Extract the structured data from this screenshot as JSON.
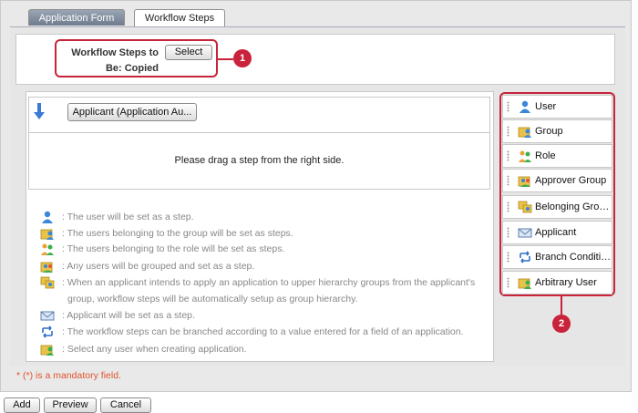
{
  "tabs": [
    {
      "label": "Application Form",
      "active": false
    },
    {
      "label": "Workflow Steps",
      "active": true
    }
  ],
  "copy_section": {
    "label": "Workflow Steps to Be: Copied",
    "select_label": "Select"
  },
  "callouts": {
    "one": "1",
    "two": "2"
  },
  "step": {
    "applicant_label": "Applicant (Application Au..."
  },
  "drop_zone": {
    "message": "Please drag a step from the right side."
  },
  "legend": [
    {
      "icon": "user-icon",
      "text": ": The user will be set as a step."
    },
    {
      "icon": "group-icon",
      "text": ": The users belonging to the group will be set as steps."
    },
    {
      "icon": "role-icon",
      "text": ": The users belonging to the role will be set as steps."
    },
    {
      "icon": "approver-group-icon",
      "text": ": Any users will be grouped and set as a step."
    },
    {
      "icon": "belonging-group-icon",
      "text": ": When an applicant intends to apply an application to upper hierarchy groups from the applicant's"
    },
    {
      "icon": "applicant-icon",
      "text": ": Applicant will be set as a step."
    },
    {
      "icon": "branch-condition-icon",
      "text": ": The workflow steps can be branched according to a value entered for a field of an application."
    },
    {
      "icon": "arbitrary-user-icon",
      "text": ": Select any user when creating application."
    }
  ],
  "legend_continuation": "group, workflow steps will be automatically setup as group hierarchy.",
  "step_types": [
    {
      "icon": "user-icon",
      "label": "User"
    },
    {
      "icon": "group-icon",
      "label": "Group"
    },
    {
      "icon": "role-icon",
      "label": "Role"
    },
    {
      "icon": "approver-group-icon",
      "label": "Approver Group"
    },
    {
      "icon": "belonging-group-icon",
      "label": "Belonging Grou..."
    },
    {
      "icon": "applicant-icon",
      "label": "Applicant"
    },
    {
      "icon": "branch-condition-icon",
      "label": "Branch Condition"
    },
    {
      "icon": "arbitrary-user-icon",
      "label": "Arbitrary User"
    }
  ],
  "mandatory_note": "* (*) is a mandatory field.",
  "footer": {
    "add_label": "Add",
    "preview_label": "Preview",
    "cancel_label": "Cancel"
  },
  "colors": {
    "callout": "#c8233a",
    "mandatory": "#e0522c",
    "tab_inactive": "#7b879a"
  }
}
